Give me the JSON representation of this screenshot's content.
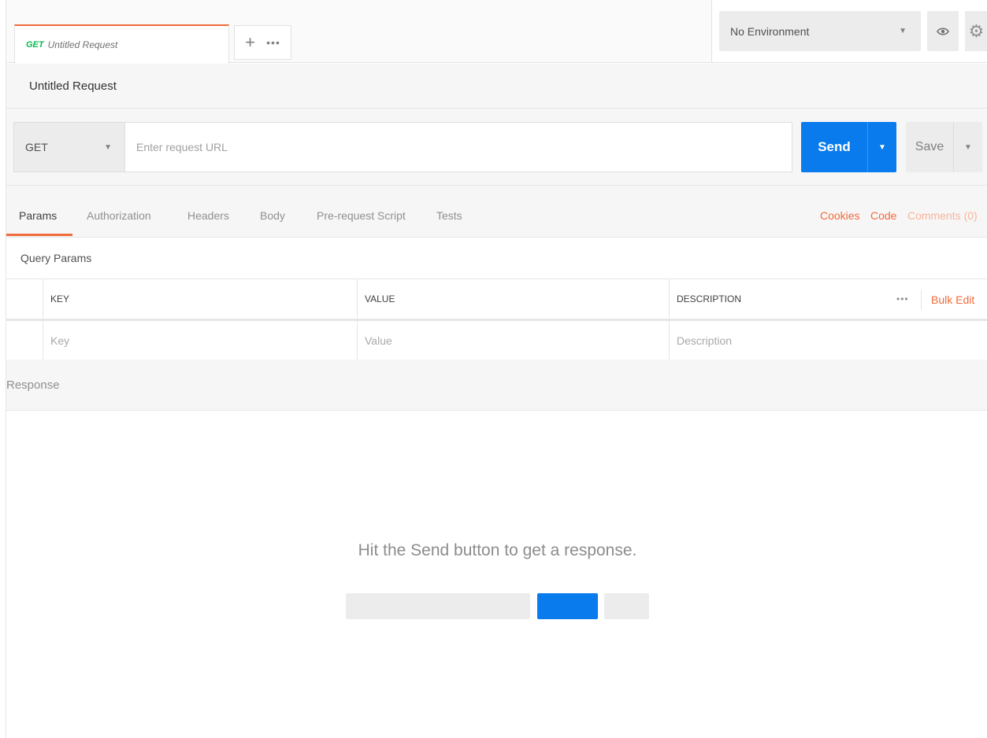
{
  "tabs": [
    {
      "method": "GET",
      "name": "Untitled Request"
    }
  ],
  "tab_actions": {
    "add_symbol": "+",
    "more_symbol": "•••"
  },
  "environment": {
    "selected": "No Environment"
  },
  "request": {
    "name": "Untitled Request",
    "method": "GET",
    "url_value": "",
    "url_placeholder": "Enter request URL",
    "send_label": "Send",
    "save_label": "Save"
  },
  "config_tabs": [
    "Params",
    "Authorization",
    "Headers",
    "Body",
    "Pre-request Script",
    "Tests"
  ],
  "active_config_tab": "Params",
  "config_links": {
    "cookies": "Cookies",
    "code": "Code",
    "comments": "Comments (0)"
  },
  "params": {
    "title": "Query Params",
    "headers": {
      "key": "KEY",
      "value": "VALUE",
      "description": "DESCRIPTION"
    },
    "more_symbol": "•••",
    "bulk_edit": "Bulk Edit",
    "placeholders": {
      "key": "Key",
      "value": "Value",
      "description": "Description"
    }
  },
  "response": {
    "title": "Response",
    "empty_message": "Hit the Send button to get a response."
  },
  "colors": {
    "accent": "#f26b3a",
    "primary": "#097bed",
    "get_method": "#0cbb52"
  },
  "icons": {
    "eye": "eye-icon",
    "settings": "gear-icon",
    "dropdown": "caret-down-icon"
  }
}
